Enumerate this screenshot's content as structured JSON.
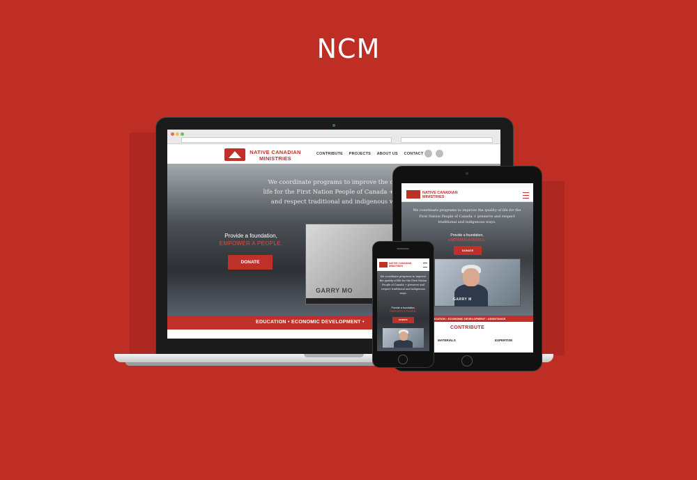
{
  "page_title": "NCM",
  "site": {
    "logo_line1": "NATIVE CANADIAN",
    "logo_line2": "MINISTRIES",
    "nav": [
      "CONTRIBUTE",
      "PROJECTS",
      "ABOUT US",
      "CONTACT"
    ],
    "social_icons": [
      "facebook-icon",
      "twitter-icon"
    ],
    "hero_desktop_line1": "We coordinate programs to improve the qua",
    "hero_desktop_line2": "life for the First Nation People of Canada + pre",
    "hero_desktop_line3": "and respect traditional and indigenous wa",
    "hero_tablet": "We coordinate programs to improve the quality of life for the First Nation People of Canada + preserve and respect traditional and indigenous ways.",
    "hero_phone": "We coordinate programs to improve the quality of life for the First Nation People of Canada + preserve and respect traditional and indigenous ways.",
    "provide_line1": "Provide a foundation,",
    "provide_line2": "EMPOWER A PEOPLE.",
    "donate_label": "DONATE",
    "video_caption_desktop": "GARRY MO",
    "video_caption_tablet": "GARRY M",
    "strip_desktop": "EDUCATION  •  ECONOMIC DEVELOPMENT  •",
    "strip_tablet": "EDUCATION  •  ECONOMIC DEVELOPMENT  •  ASSISTANCE",
    "contribute_heading": "CONTRIBUTE",
    "materials_label": "MATERIALS",
    "expertise_label": "EXPERTISE"
  },
  "colors": {
    "background": "#bf2e25",
    "brand_red": "#c0302a",
    "accent_red": "#e64a3c"
  }
}
